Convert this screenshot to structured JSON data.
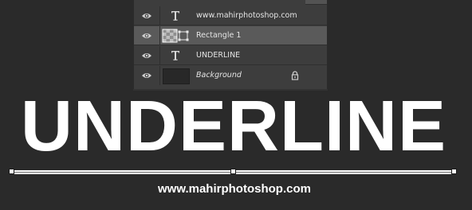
{
  "layers_panel": {
    "layers": [
      {
        "name": "www.mahirphotoshop.com",
        "kind": "type",
        "italic": false,
        "selected": false,
        "locked": false
      },
      {
        "name": "Rectangle 1",
        "kind": "shape",
        "italic": false,
        "selected": true,
        "locked": false
      },
      {
        "name": "UNDERLINE",
        "kind": "type",
        "italic": false,
        "selected": false,
        "locked": false
      },
      {
        "name": "Background",
        "kind": "background",
        "italic": true,
        "selected": false,
        "locked": true
      }
    ],
    "icons": {
      "visibility": "eye-icon",
      "type_thumbnail": "type-layer-icon",
      "lock": "lock-icon"
    }
  },
  "canvas": {
    "headline": "UNDERLINE",
    "url": "www.mahirphotoshop.com",
    "colors": {
      "background": "#2a2a2a",
      "text": "#ffffff",
      "panel": "#3d3d3d",
      "selected_row": "#5a5a5a"
    }
  }
}
